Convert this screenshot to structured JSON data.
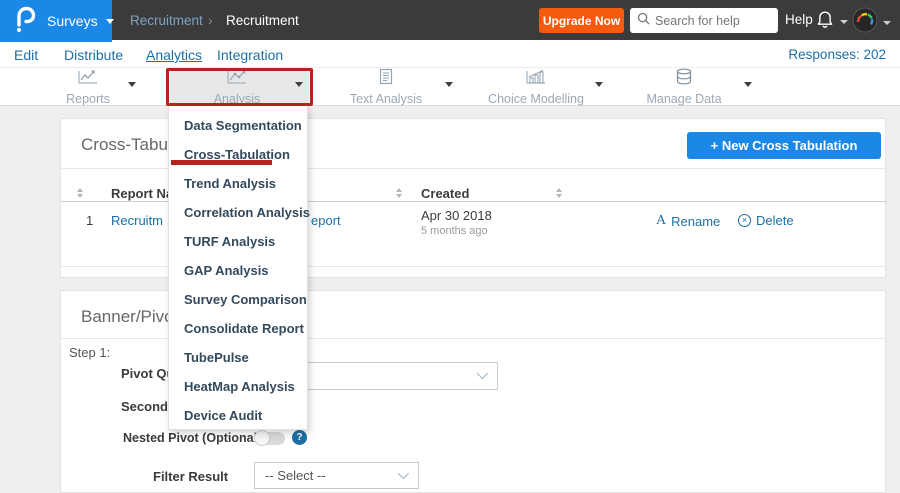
{
  "topbar": {
    "product": "Surveys",
    "breadcrumb_parent": "Recruitment",
    "breadcrumb_separator": "›",
    "breadcrumb_current": "Recruitment",
    "upgrade": "Upgrade Now",
    "search_placeholder": "Search for help",
    "help": "Help"
  },
  "nav": {
    "items": [
      "Edit",
      "Distribute",
      "Analytics",
      "Integration"
    ],
    "active_item": "Analytics",
    "responses": "Responses: 202"
  },
  "toolbar": {
    "buttons": [
      {
        "label": "Reports",
        "icon": "line-chart"
      },
      {
        "label": "Analysis",
        "icon": "scatter-chart"
      },
      {
        "label": "Text Analysis",
        "icon": "document-chart"
      },
      {
        "label": "Choice Modelling",
        "icon": "bar-chart"
      },
      {
        "label": "Manage Data",
        "icon": "database"
      }
    ]
  },
  "analysis_menu": {
    "items": [
      "Data Segmentation",
      "Cross-Tabulation",
      "Trend Analysis",
      "Correlation Analysis",
      "TURF Analysis",
      "GAP Analysis",
      "Survey Comparison",
      "Consolidate Report",
      "TubePulse",
      "HeatMap Analysis",
      "Device Audit"
    ],
    "highlighted_item": "Cross-Tabulation"
  },
  "cross_tab_card": {
    "title_visible": "Cross-Tabula",
    "new_button_label": "New Cross Tabulation",
    "table": {
      "report_name_header_visible": "Report Na",
      "created_header": "Created",
      "row_index": "1",
      "report_name_left": "Recruitm",
      "report_name_right": "eport",
      "created_date": "Apr 30 2018",
      "created_relative": "5 months ago",
      "rename": "Rename",
      "delete": "Delete"
    }
  },
  "banner_card": {
    "title_visible": "Banner/Pivo",
    "step": "Step 1:",
    "pivot_label_visible": "Pivot Que",
    "secondary_label_visible": "Secondary",
    "nested_pivot_label": "Nested Pivot (Optional)",
    "filter_label": "Filter Result",
    "filter_value": "-- Select --"
  },
  "icons": {
    "rename_glyph": "A",
    "delete_glyph": "×",
    "help_glyph": "?",
    "plus_glyph": "+"
  },
  "colors": {
    "accent_blue": "#1b87e6",
    "link_blue": "#1d6fa5",
    "upgrade_orange": "#f55a0f",
    "annotation_red": "#b3231f",
    "topbar_dark": "#3b3b3b"
  }
}
